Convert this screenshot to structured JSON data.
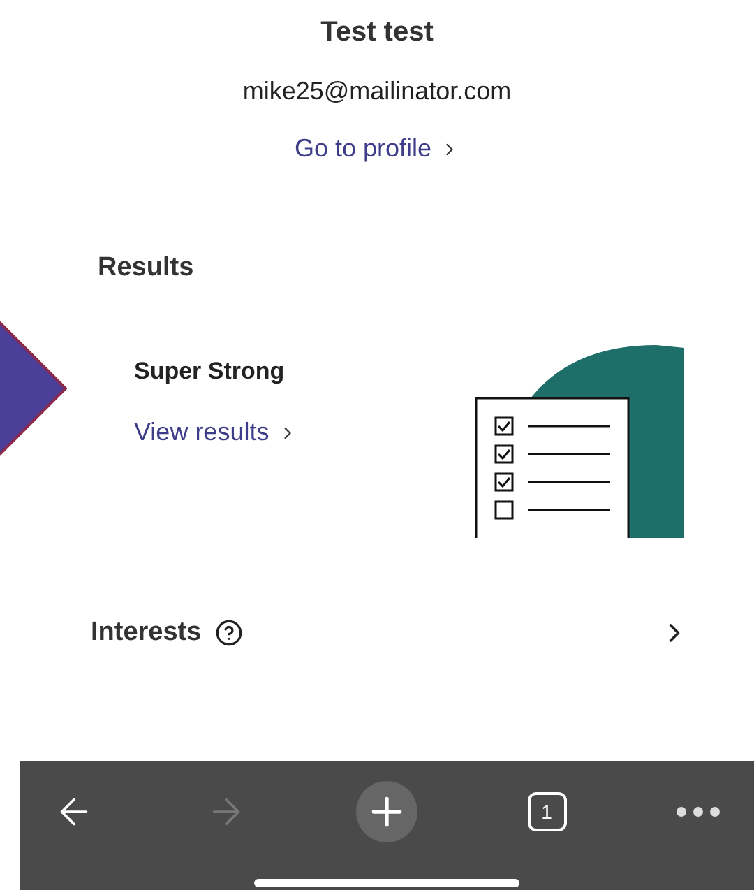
{
  "profile": {
    "name": "Test test",
    "email": "mike25@mailinator.com",
    "link": "Go to profile"
  },
  "results": {
    "heading": "Results",
    "title": "Super Strong",
    "link": "View results"
  },
  "interests": {
    "label": "Interests"
  },
  "toolbar": {
    "back": {
      "disabled": false
    },
    "forward": {
      "disabled": true
    },
    "tab_count": "1"
  }
}
